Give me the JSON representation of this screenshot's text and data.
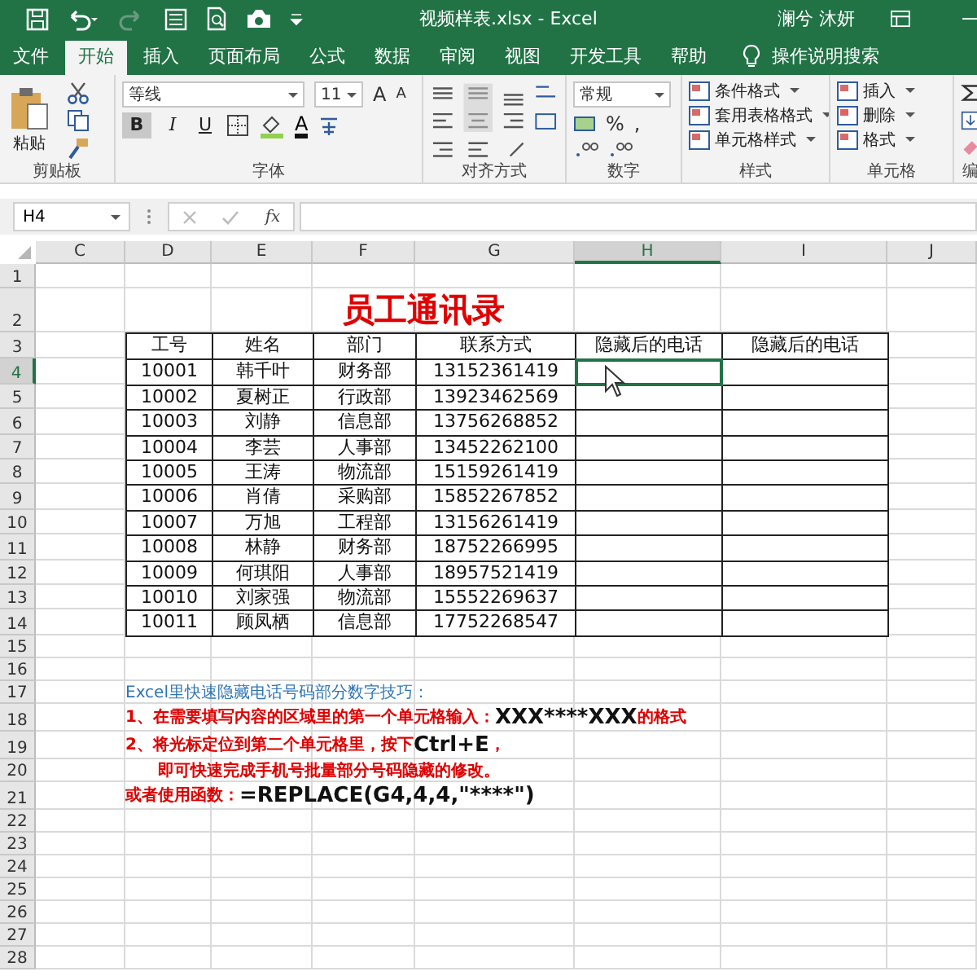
{
  "window": {
    "title": "视频样表.xlsx  -  Excel",
    "user": "澜兮 沐妍"
  },
  "tabs": [
    {
      "label": "文件",
      "selected": false
    },
    {
      "label": "开始",
      "selected": true
    },
    {
      "label": "插入",
      "selected": false
    },
    {
      "label": "页面布局",
      "selected": false
    },
    {
      "label": "公式",
      "selected": false
    },
    {
      "label": "数据",
      "selected": false
    },
    {
      "label": "审阅",
      "selected": false
    },
    {
      "label": "视图",
      "selected": false
    },
    {
      "label": "开发工具",
      "selected": false
    },
    {
      "label": "帮助",
      "selected": false
    }
  ],
  "tell_me": "操作说明搜索",
  "ribbon_groups": [
    {
      "kind": "clipboard",
      "label": "剪贴板",
      "paste": "粘贴"
    },
    {
      "kind": "font",
      "label": "字体",
      "font_name": "等线",
      "font_size": "11",
      "grow": "A",
      "shrink": "A",
      "bold": "B",
      "italic": "I",
      "underline": "U",
      "font_color": "A"
    },
    {
      "kind": "alignment",
      "label": "对齐方式"
    },
    {
      "kind": "number",
      "label": "数字",
      "format": "常规",
      "percent": "%",
      "comma": ","
    },
    {
      "kind": "styles",
      "label": "样式",
      "items": [
        "条件格式",
        "套用表格格式",
        "单元格样式"
      ]
    },
    {
      "kind": "cells",
      "label": "单元格",
      "items": [
        "插入",
        "删除",
        "格式"
      ]
    },
    {
      "kind": "editing",
      "label": "编"
    }
  ],
  "name_box": "H4",
  "fx": "fx",
  "columns": [
    {
      "label": "C",
      "selected": false
    },
    {
      "label": "D",
      "selected": false
    },
    {
      "label": "E",
      "selected": false
    },
    {
      "label": "F",
      "selected": false
    },
    {
      "label": "G",
      "selected": false
    },
    {
      "label": "H",
      "selected": true
    },
    {
      "label": "I",
      "selected": false
    },
    {
      "label": "J",
      "selected": false
    }
  ],
  "rows": [
    {
      "label": "1",
      "selected": false
    },
    {
      "label": "2",
      "selected": false
    },
    {
      "label": "3",
      "selected": false
    },
    {
      "label": "4",
      "selected": true
    },
    {
      "label": "5",
      "selected": false
    },
    {
      "label": "6",
      "selected": false
    },
    {
      "label": "7",
      "selected": false
    },
    {
      "label": "8",
      "selected": false
    },
    {
      "label": "9",
      "selected": false
    },
    {
      "label": "10",
      "selected": false
    },
    {
      "label": "11",
      "selected": false
    },
    {
      "label": "12",
      "selected": false
    },
    {
      "label": "13",
      "selected": false
    },
    {
      "label": "14",
      "selected": false
    },
    {
      "label": "15",
      "selected": false
    },
    {
      "label": "16",
      "selected": false
    },
    {
      "label": "17",
      "selected": false
    },
    {
      "label": "18",
      "selected": false
    },
    {
      "label": "19",
      "selected": false
    },
    {
      "label": "20",
      "selected": false
    },
    {
      "label": "21",
      "selected": false
    },
    {
      "label": "22",
      "selected": false
    },
    {
      "label": "23",
      "selected": false
    },
    {
      "label": "24",
      "selected": false
    },
    {
      "label": "25",
      "selected": false
    },
    {
      "label": "26",
      "selected": false
    },
    {
      "label": "27",
      "selected": false
    },
    {
      "label": "28",
      "selected": false
    }
  ],
  "sheet_title": "员工通讯录",
  "table": {
    "columns": [
      "工号",
      "姓名",
      "部门",
      "联系方式",
      "隐藏后的电话",
      "隐藏后的电话"
    ],
    "rows": [
      [
        "10001",
        "韩千叶",
        "财务部",
        "13152361419",
        "",
        ""
      ],
      [
        "10002",
        "夏树正",
        "行政部",
        "13923462569",
        "",
        ""
      ],
      [
        "10003",
        "刘静",
        "信息部",
        "13756268852",
        "",
        ""
      ],
      [
        "10004",
        "李芸",
        "人事部",
        "13452262100",
        "",
        ""
      ],
      [
        "10005",
        "王涛",
        "物流部",
        "15159261419",
        "",
        ""
      ],
      [
        "10006",
        "肖倩",
        "采购部",
        "15852267852",
        "",
        ""
      ],
      [
        "10007",
        "万旭",
        "工程部",
        "13156261419",
        "",
        ""
      ],
      [
        "10008",
        "林静",
        "财务部",
        "18752266995",
        "",
        ""
      ],
      [
        "10009",
        "何琪阳",
        "人事部",
        "18957521419",
        "",
        ""
      ],
      [
        "10010",
        "刘家强",
        "物流部",
        "15552269637",
        "",
        ""
      ],
      [
        "10011",
        "顾凤栖",
        "信息部",
        "17752268547",
        "",
        ""
      ]
    ]
  },
  "notes": [
    {
      "indent": false,
      "parts": [
        {
          "kind": "heading",
          "text": "Excel里快速隐藏电话号码部分数字技巧："
        }
      ]
    },
    {
      "indent": false,
      "parts": [
        {
          "kind": "step",
          "text": "1、在需要填写内容的区域里的第一个单元格输入："
        },
        {
          "kind": "key",
          "text": "XXX****XXX"
        },
        {
          "kind": "step",
          "text": "的格式"
        }
      ]
    },
    {
      "indent": false,
      "parts": [
        {
          "kind": "step",
          "text": "2、将光标定位到第二个单元格里，按下"
        },
        {
          "kind": "key",
          "text": "Ctrl+E"
        },
        {
          "kind": "step",
          "text": "，"
        }
      ]
    },
    {
      "indent": true,
      "parts": [
        {
          "kind": "step",
          "text": "即可快速完成手机号批量部分号码隐藏的修改。"
        }
      ]
    },
    {
      "indent": false,
      "parts": [
        {
          "kind": "step",
          "text": "或者使用函数："
        },
        {
          "kind": "key",
          "text": "=REPLACE(G4,4,4,\"****\")"
        }
      ]
    }
  ]
}
